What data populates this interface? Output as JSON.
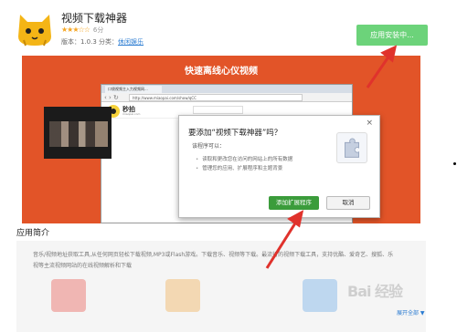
{
  "app": {
    "title": "视频下载神器",
    "stars": "★★★☆☆",
    "score": "6分",
    "version_label": "版本：1.0.3 分类：",
    "category": "休闲娱乐",
    "install_button": "应用安装中..."
  },
  "banner": {
    "title": "快速离线心仪视频",
    "browser": {
      "tab_label": "口袋视频主入力视频网...",
      "url": "http://www.miaopai.com/show/qCC",
      "site_name": "秒拍",
      "site_sub": "miaopai.com",
      "search_hint": ""
    }
  },
  "dialog": {
    "title": "要添加“视频下载神器”吗？",
    "desc": "该程序可以：",
    "permissions": [
      "读取和更改您在访问的网站上的所有数据",
      "管理您的应用、扩展程序和主题背景"
    ],
    "add_button": "添加扩展程序",
    "cancel_button": "取消",
    "close": "×"
  },
  "intro": {
    "title": "应用简介",
    "text": "音乐/视频地址获取工具,从任何网页轻松下载视频,MP3或Flash游戏。下载音乐、视频等下载。最流行的视频下载工具，支持优酷、爱奇艺、搜狐、乐视等主流视频网站的在线视频解析和下载",
    "expand": "展开全部 ▼"
  },
  "watermark": "Bai 经验",
  "colors": {
    "install_green": "#6cd37a",
    "banner_orange": "#e25428",
    "add_green": "#3b9c3b",
    "arrow_red": "#e0322c",
    "star": "#f5a623"
  }
}
